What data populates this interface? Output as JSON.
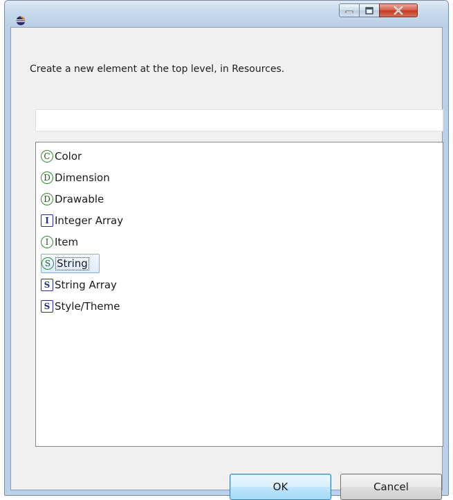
{
  "window": {
    "app_icon": "eclipse-icon",
    "controls": {
      "minimize_icon": "minimize-icon",
      "maximize_icon": "maximize-icon",
      "close_icon": "close-icon",
      "close_color": "#c43b23"
    }
  },
  "dialog": {
    "message": "Create a new element at the top level, in Resources.",
    "filter": {
      "value": "",
      "placeholder": ""
    },
    "items": [
      {
        "label": "Color",
        "icon_letter": "C",
        "icon_shape": "circle",
        "icon_name": "color-element-icon",
        "selected": false
      },
      {
        "label": "Dimension",
        "icon_letter": "D",
        "icon_shape": "circle",
        "icon_name": "dimension-element-icon",
        "selected": false
      },
      {
        "label": "Drawable",
        "icon_letter": "D",
        "icon_shape": "circle",
        "icon_name": "drawable-element-icon",
        "selected": false
      },
      {
        "label": "Integer Array",
        "icon_letter": "I",
        "icon_shape": "square",
        "icon_name": "integer-array-element-icon",
        "selected": false
      },
      {
        "label": "Item",
        "icon_letter": "I",
        "icon_shape": "circle",
        "icon_name": "item-element-icon",
        "selected": false
      },
      {
        "label": "String",
        "icon_letter": "S",
        "icon_shape": "circle",
        "icon_name": "string-element-icon",
        "selected": true
      },
      {
        "label": "String Array",
        "icon_letter": "S",
        "icon_shape": "square",
        "icon_name": "string-array-element-icon",
        "selected": false
      },
      {
        "label": "Style/Theme",
        "icon_letter": "S",
        "icon_shape": "square",
        "icon_name": "style-theme-element-icon",
        "selected": false
      }
    ],
    "ok_label": "OK",
    "cancel_label": "Cancel"
  },
  "colors": {
    "circle_icon": "#2e8b2e",
    "square_icon": "#1f2f8a",
    "selection_border": "#84acdd",
    "ok_border": "#3c7fb1"
  }
}
